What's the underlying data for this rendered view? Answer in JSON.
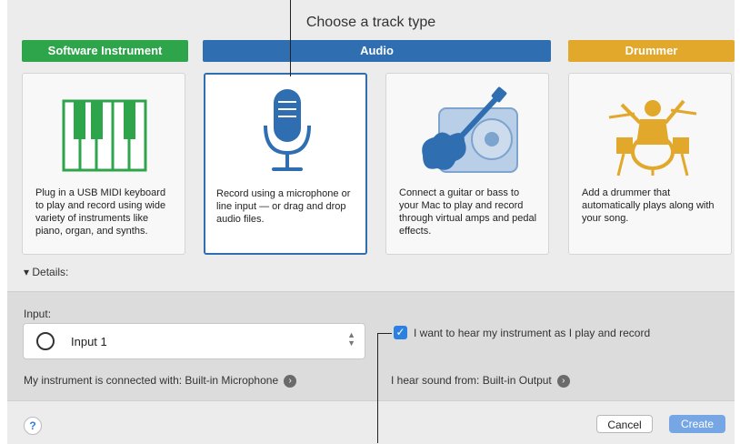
{
  "dialog": {
    "title": "Choose a track type",
    "categories": [
      {
        "label": "Software Instrument",
        "color": "#2ea44b"
      },
      {
        "label": "Audio",
        "color": "#2f6fb1"
      },
      {
        "label": "Drummer",
        "color": "#e1a82b"
      }
    ],
    "cards": [
      {
        "desc": "Plug in a USB MIDI keyboard to play and record using wide variety of instruments like piano, organ, and synths.",
        "icon": "keyboard-icon"
      },
      {
        "desc": "Record using a microphone or line input — or drag and drop audio files.",
        "icon": "microphone-icon"
      },
      {
        "desc": "Connect a guitar or bass to your Mac to play and record through virtual amps and pedal effects.",
        "icon": "guitar-icon"
      },
      {
        "desc": "Add a drummer that automatically plays along with your song.",
        "icon": "drummer-icon"
      }
    ],
    "details_label": "▾ Details:"
  },
  "details": {
    "input_label": "Input:",
    "input_value": "Input 1",
    "connected_text": "My instrument is connected with: Built-in Microphone",
    "monitor_label": "I want to hear my instrument as I play and record",
    "monitor_checked": true,
    "output_text": "I hear sound from: Built-in Output"
  },
  "footer": {
    "help_label": "?",
    "cancel_label": "Cancel",
    "create_label": "Create"
  }
}
